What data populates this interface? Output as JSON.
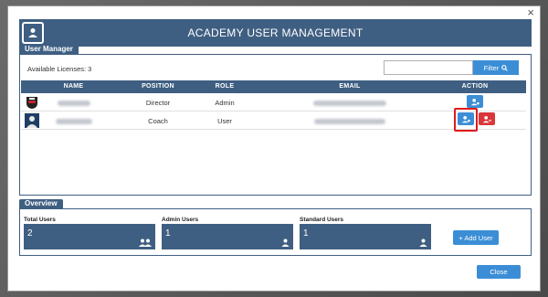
{
  "dialog": {
    "title": "ACADEMY USER MANAGEMENT",
    "close_glyph": "×",
    "close_button_label": "Close"
  },
  "user_manager": {
    "section_label": "User Manager",
    "available_licenses": "Available Licenses: 3",
    "filter": {
      "placeholder": "",
      "value": "",
      "button_label": "Filter",
      "button_icon": "search-icon"
    },
    "columns": [
      "NAME",
      "POSITION",
      "ROLE",
      "EMAIL",
      "ACTION"
    ],
    "rows": [
      {
        "name": "Carl Miller",
        "position": "Director",
        "role": "Admin",
        "email": "carl.miller@academy.com",
        "avatar": "club-crest",
        "actions": [
          "edit-user"
        ]
      },
      {
        "name": "Carl Millard",
        "position": "Coach",
        "role": "User",
        "email": "c.millard@academy.com",
        "avatar": "profile-silhouette",
        "actions": [
          "edit-user",
          "remove-user"
        ]
      }
    ]
  },
  "overview": {
    "section_label": "Overview",
    "stats": [
      {
        "label": "Total Users",
        "value": "2",
        "icon": "users-group-icon"
      },
      {
        "label": "Admin Users",
        "value": "1",
        "icon": "user-icon"
      },
      {
        "label": "Standard Users",
        "value": "1",
        "icon": "user-icon"
      }
    ],
    "add_user_label": "+ Add User"
  },
  "colors": {
    "primary": "#3f5f82",
    "accent": "#3b8ed6",
    "danger": "#d9373b",
    "highlight": "#e01b1b"
  }
}
